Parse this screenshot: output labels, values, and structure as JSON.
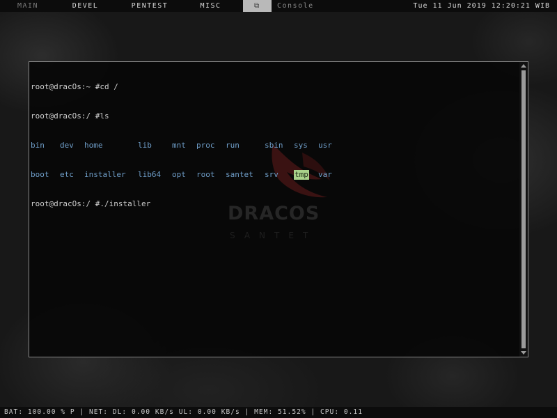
{
  "topbar": {
    "workspaces": [
      "MAIN",
      "DEVEL",
      "PENTEST",
      "MISC"
    ],
    "layout_icon": "layout-tile-icon",
    "layout_glyph": "⧉",
    "window_title": "Console",
    "clock": "Tue 11 Jun 2019 12:20:21 WIB"
  },
  "terminal": {
    "line1": "root@dracOs:~ #cd /",
    "line2": "root@dracOs:/ #ls",
    "ls_row1": [
      "bin",
      "dev",
      "home",
      "lib",
      "mnt",
      "proc",
      "run",
      "sbin",
      "sys",
      "usr"
    ],
    "ls_row2": [
      "boot",
      "etc",
      "installer",
      "lib64",
      "opt",
      "root",
      "santet",
      "srv",
      "tmp",
      "var"
    ],
    "line5": "root@dracOs:/ #./installer",
    "highlighted_entry": "tmp",
    "colors": {
      "directory": "#6f9ec9",
      "highlight_bg": "#a9d28a",
      "text": "#cfcfcf"
    }
  },
  "wallpaper": {
    "logo_word": "DRACOS",
    "logo_sub": "SANTET"
  },
  "statusbar": {
    "text": "BAT: 100.00 % P | NET: DL: 0.00 KB/s UL: 0.00 KB/s | MEM: 51.52% | CPU: 0.11"
  }
}
